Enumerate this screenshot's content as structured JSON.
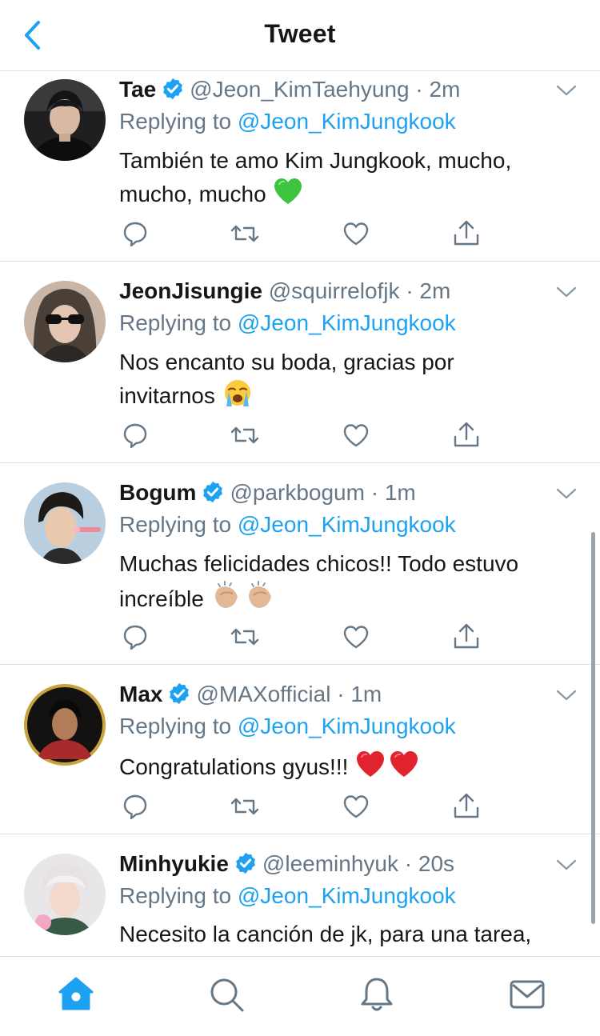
{
  "header": {
    "title": "Tweet"
  },
  "reply_prefix": "Replying to",
  "dot": "·",
  "tweets": [
    {
      "name": "Tae",
      "verified": true,
      "handle": "@Jeon_KimTaehyung",
      "time": "2m",
      "replying_to": "@Jeon_KimJungkook",
      "text_line1": "También te amo Kim Jungkook, mucho,",
      "text_line2": "mucho, mucho",
      "emoji": "green-heart"
    },
    {
      "name": "JeonJisungie",
      "verified": false,
      "handle": "@squirrelofjk",
      "time": "2m",
      "replying_to": "@Jeon_KimJungkook",
      "text_line1": "Nos encanto su boda, gracias por",
      "text_line2": "invitarnos",
      "emoji": "loudly-crying-face"
    },
    {
      "name": "Bogum",
      "verified": true,
      "handle": "@parkbogum",
      "time": "1m",
      "replying_to": "@Jeon_KimJungkook",
      "text_line1": "Muchas felicidades chicos!! Todo estuvo",
      "text_line2": "increíble",
      "emoji": "clapping-hands"
    },
    {
      "name": "Max",
      "verified": true,
      "handle": "@MAXofficial",
      "time": "1m",
      "replying_to": "@Jeon_KimJungkook",
      "text_line1": "Congratulations gyus!!!",
      "text_line2": "",
      "emoji": "red-hearts"
    },
    {
      "name": "Minhyukie",
      "verified": true,
      "handle": "@leeminhyuk",
      "time": "20s",
      "replying_to": "@Jeon_KimJungkook",
      "text_line1": "Necesito la canción de jk, para una tarea,",
      "text_line2": "",
      "emoji": ""
    }
  ],
  "tabs": [
    {
      "icon": "home-icon",
      "active": true
    },
    {
      "icon": "search-icon",
      "active": false
    },
    {
      "icon": "bell-icon",
      "active": false
    },
    {
      "icon": "mail-icon",
      "active": false
    }
  ],
  "colors": {
    "accent": "#1da1f2",
    "muted": "#657786",
    "text": "#14171a",
    "border": "#dfe3e6"
  }
}
